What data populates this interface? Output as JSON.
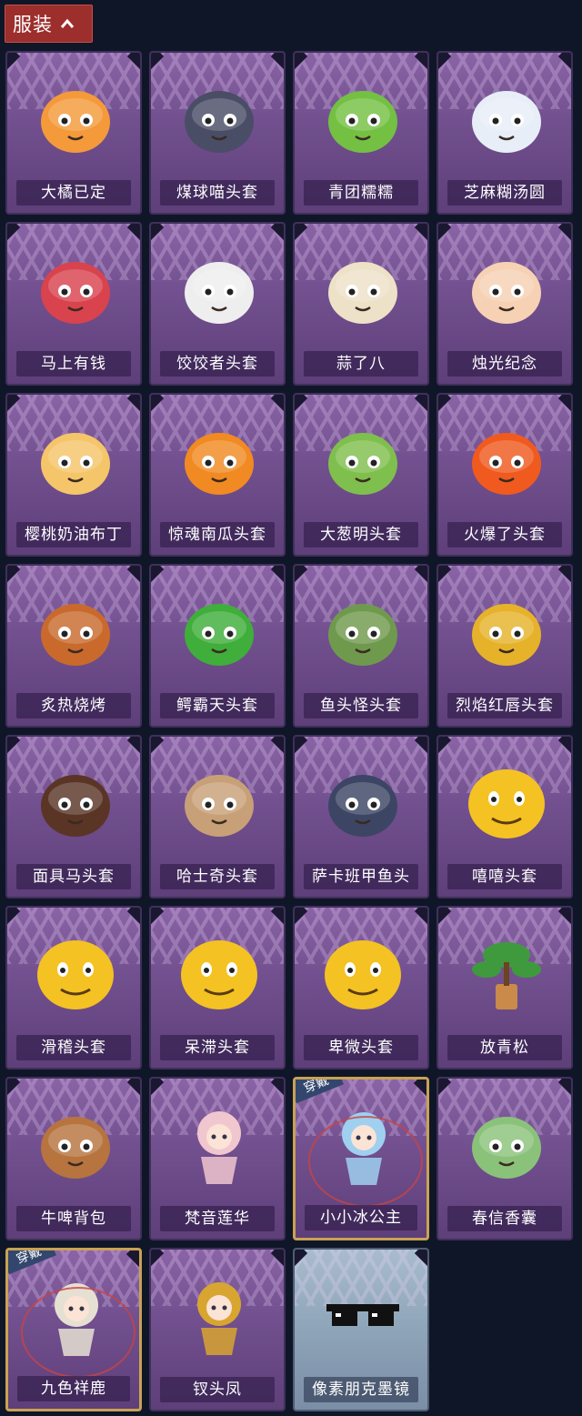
{
  "header": {
    "label": "服装"
  },
  "wear_badge": "穿戴",
  "items": [
    {
      "name": "大橘已定",
      "icon": "orange-slice-icon",
      "color": "#f49a3a"
    },
    {
      "name": "煤球喵头套",
      "icon": "gray-cat-head-icon",
      "color": "#4a4d66"
    },
    {
      "name": "青团糯糯",
      "icon": "green-dumpling-icon",
      "color": "#74c043"
    },
    {
      "name": "芝麻糊汤圆",
      "icon": "white-dumpling-icon",
      "color": "#e8eef8"
    },
    {
      "name": "马上有钱",
      "icon": "red-horse-head-icon",
      "color": "#d8434e"
    },
    {
      "name": "饺饺者头套",
      "icon": "cloud-head-icon",
      "color": "#eeeeee"
    },
    {
      "name": "蒜了八",
      "icon": "garlic-head-icon",
      "color": "#ede1c8"
    },
    {
      "name": "烛光纪念",
      "icon": "candle-head-icon",
      "color": "#f6d1b4"
    },
    {
      "name": "樱桃奶油布丁",
      "icon": "pudding-head-icon",
      "color": "#f5c56a"
    },
    {
      "name": "惊魂南瓜头套",
      "icon": "pumpkin-head-icon",
      "color": "#f18a22"
    },
    {
      "name": "大葱明头套",
      "icon": "green-onion-head-icon",
      "color": "#7fbf4d"
    },
    {
      "name": "火爆了头套",
      "icon": "fire-head-icon",
      "color": "#f05a1e"
    },
    {
      "name": "炙热烧烤",
      "icon": "meat-bone-head-icon",
      "color": "#c96a2c"
    },
    {
      "name": "鳄霸天头套",
      "icon": "crocodile-head-icon",
      "color": "#3fae3a"
    },
    {
      "name": "鱼头怪头套",
      "icon": "fish-head-mask-icon",
      "color": "#6f9a4e"
    },
    {
      "name": "烈焰红唇头套",
      "icon": "yellow-mask-sunglasses-icon",
      "color": "#e6b22a"
    },
    {
      "name": "面具马头套",
      "icon": "horse-mask-icon",
      "color": "#5a3526"
    },
    {
      "name": "哈士奇头套",
      "icon": "dog-head-sunglasses-icon",
      "color": "#c7a078"
    },
    {
      "name": "萨卡班甲鱼头",
      "icon": "fish-head-icon",
      "color": "#3c4664"
    },
    {
      "name": "嘻嘻头套",
      "icon": "grin-emoji-icon",
      "color": "#f5c223"
    },
    {
      "name": "滑稽头套",
      "icon": "smirk-emoji-icon",
      "color": "#f5c223"
    },
    {
      "name": "呆滞头套",
      "icon": "stare-emoji-icon",
      "color": "#f5c223"
    },
    {
      "name": "卑微头套",
      "icon": "pleading-emoji-icon",
      "color": "#f5c223"
    },
    {
      "name": "放青松",
      "icon": "bonsai-tree-icon",
      "color": "#3f9a3e"
    },
    {
      "name": "牛啤背包",
      "icon": "cow-beer-backpack-icon",
      "color": "#b7743f"
    },
    {
      "name": "梵音莲华",
      "icon": "lotus-girl-icon",
      "color": "#f0c6cf"
    },
    {
      "name": "小小冰公主",
      "icon": "ice-princess-icon",
      "color": "#9fd0f0",
      "worn": true
    },
    {
      "name": "春信香囊",
      "icon": "sachet-icon",
      "color": "#8ac27a"
    },
    {
      "name": "九色祥鹿",
      "icon": "deer-charm-icon",
      "color": "#e6e0d2",
      "worn": true
    },
    {
      "name": "钗头凤",
      "icon": "phoenix-crown-girl-icon",
      "color": "#d8a530"
    },
    {
      "name": "像素朋克墨镜",
      "icon": "pixel-sunglasses-icon",
      "color": "#111111",
      "special": true
    }
  ]
}
